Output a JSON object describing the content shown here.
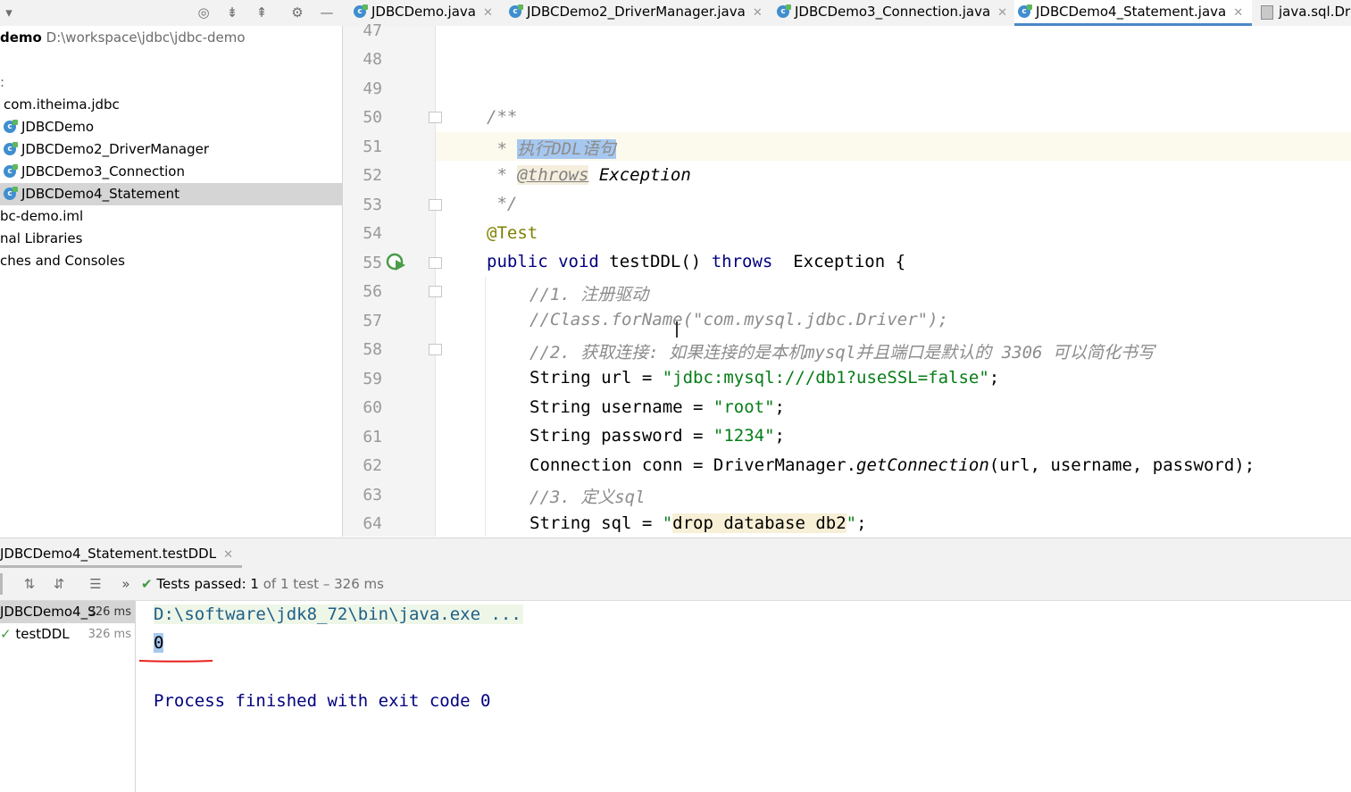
{
  "project": {
    "header_name": "demo",
    "header_path": "D:\\workspace\\jdbc\\jdbc-demo",
    "items": [
      {
        "label": ":"
      },
      {
        "label": "com.itheima.jdbc"
      },
      {
        "label": "JDBCDemo"
      },
      {
        "label": "JDBCDemo2_DriverManager"
      },
      {
        "label": "JDBCDemo3_Connection"
      },
      {
        "label": "JDBCDemo4_Statement"
      },
      {
        "label": "bc-demo.iml"
      },
      {
        "label": "nal Libraries"
      },
      {
        "label": "ches and Consoles"
      }
    ]
  },
  "tabs": [
    {
      "label": "JDBCDemo.java"
    },
    {
      "label": "JDBCDemo2_DriverManager.java"
    },
    {
      "label": "JDBCDemo3_Connection.java"
    },
    {
      "label": "JDBCDemo4_Statement.java"
    },
    {
      "label": "java.sql.Dri"
    }
  ],
  "editor": {
    "line_numbers": [
      "47",
      "48",
      "49",
      "50",
      "51",
      "52",
      "53",
      "54",
      "55",
      "56",
      "57",
      "58",
      "59",
      "60",
      "61",
      "62",
      "63",
      "64"
    ],
    "code": {
      "l50": "/**",
      "l51_star": " * ",
      "l51_text": "执行DDL语句",
      "l52_star": " * ",
      "l52_tag": "@throws",
      "l52_rest": " Exception",
      "l53": " */",
      "l54": "@Test",
      "l55_kw": "public void",
      "l55_name": " testDDL() ",
      "l55_throws": "throws",
      "l55_rest": "  Exception {",
      "l56": "//1. 注册驱动",
      "l57": "//Class.forName(\"com.mysql.jdbc.Driver\");",
      "l58": "//2. 获取连接: 如果连接的是本机mysql并且端口是默认的 3306 可以简化书写",
      "l59_a": "String url = ",
      "l59_str": "\"jdbc:mysql:///db1?useSSL=false\"",
      "l59_b": ";",
      "l60_a": "String username = ",
      "l60_str": "\"root\"",
      "l60_b": ";",
      "l61_a": "String password = ",
      "l61_str": "\"1234\"",
      "l61_b": ";",
      "l62_a": "Connection conn = DriverManager.",
      "l62_m": "getConnection",
      "l62_b": "(url, username, password);",
      "l63": "//3. 定义sql",
      "l64_a": "String sql = ",
      "l64_q1": "\"",
      "l64_str": "drop database db2",
      "l64_q2": "\"",
      "l64_b": ";"
    }
  },
  "run": {
    "tab_label": "JDBCDemo4_Statement.testDDL",
    "status_prefix": "Tests passed: ",
    "status_count": "1",
    "status_suffix": " of 1 test – 326 ms",
    "tree": [
      {
        "label": "JDBCDemo4_S",
        "time": "326 ms"
      },
      {
        "label": "testDDL",
        "time": "326 ms"
      }
    ],
    "console": {
      "command": "D:\\software\\jdk8_72\\bin\\java.exe ...",
      "output": "0",
      "finish": "Process finished with exit code 0"
    }
  },
  "colors": {
    "accent": "#4a86c8",
    "string": "#067d17",
    "keyword": "#000080",
    "annotation_red": "#e8201c"
  }
}
